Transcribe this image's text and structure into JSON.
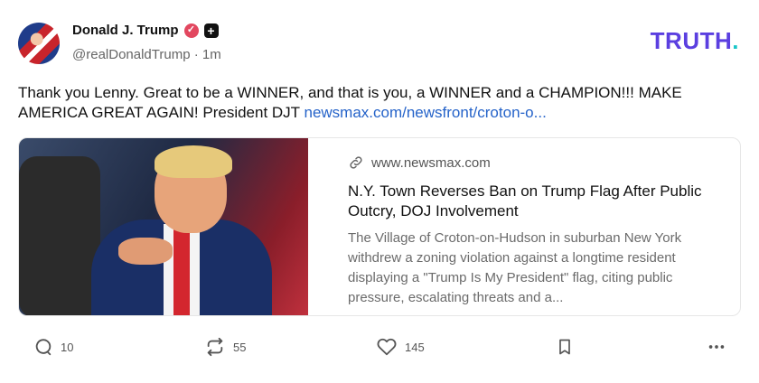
{
  "author": {
    "display_name": "Donald J. Trump",
    "handle": "@realDonaldTrump",
    "separator": "·",
    "time": "1m"
  },
  "brand": {
    "logo_text": "TRUTH",
    "logo_dot": "."
  },
  "post": {
    "text": "Thank you Lenny. Great to be a WINNER, and that is you, a WINNER and a CHAMPION!!! MAKE AMERICA GREAT AGAIN! President DJT ",
    "link_text": "newsmax.com/newsfront/croton-o..."
  },
  "card": {
    "domain": "www.newsmax.com",
    "title": "N.Y. Town Reverses Ban on Trump Flag After Public Outcry, DOJ Involvement",
    "description": "The Village of Croton-on-Hudson in suburban New York withdrew a zoning violation against a longtime resident displaying a \"Trump Is My President\" flag, citing public pressure, escalating threats and a..."
  },
  "actions": {
    "replies": "10",
    "retruths": "55",
    "likes": "145"
  },
  "icons": [
    "verified-icon",
    "plus-icon",
    "link-icon",
    "reply-icon",
    "retruth-icon",
    "heart-icon",
    "bookmark-icon",
    "more-icon"
  ],
  "colors": {
    "brand": "#5b3fe0",
    "brand_dot": "#18c5c8",
    "link": "#2563c9",
    "verified": "#e2475f"
  }
}
